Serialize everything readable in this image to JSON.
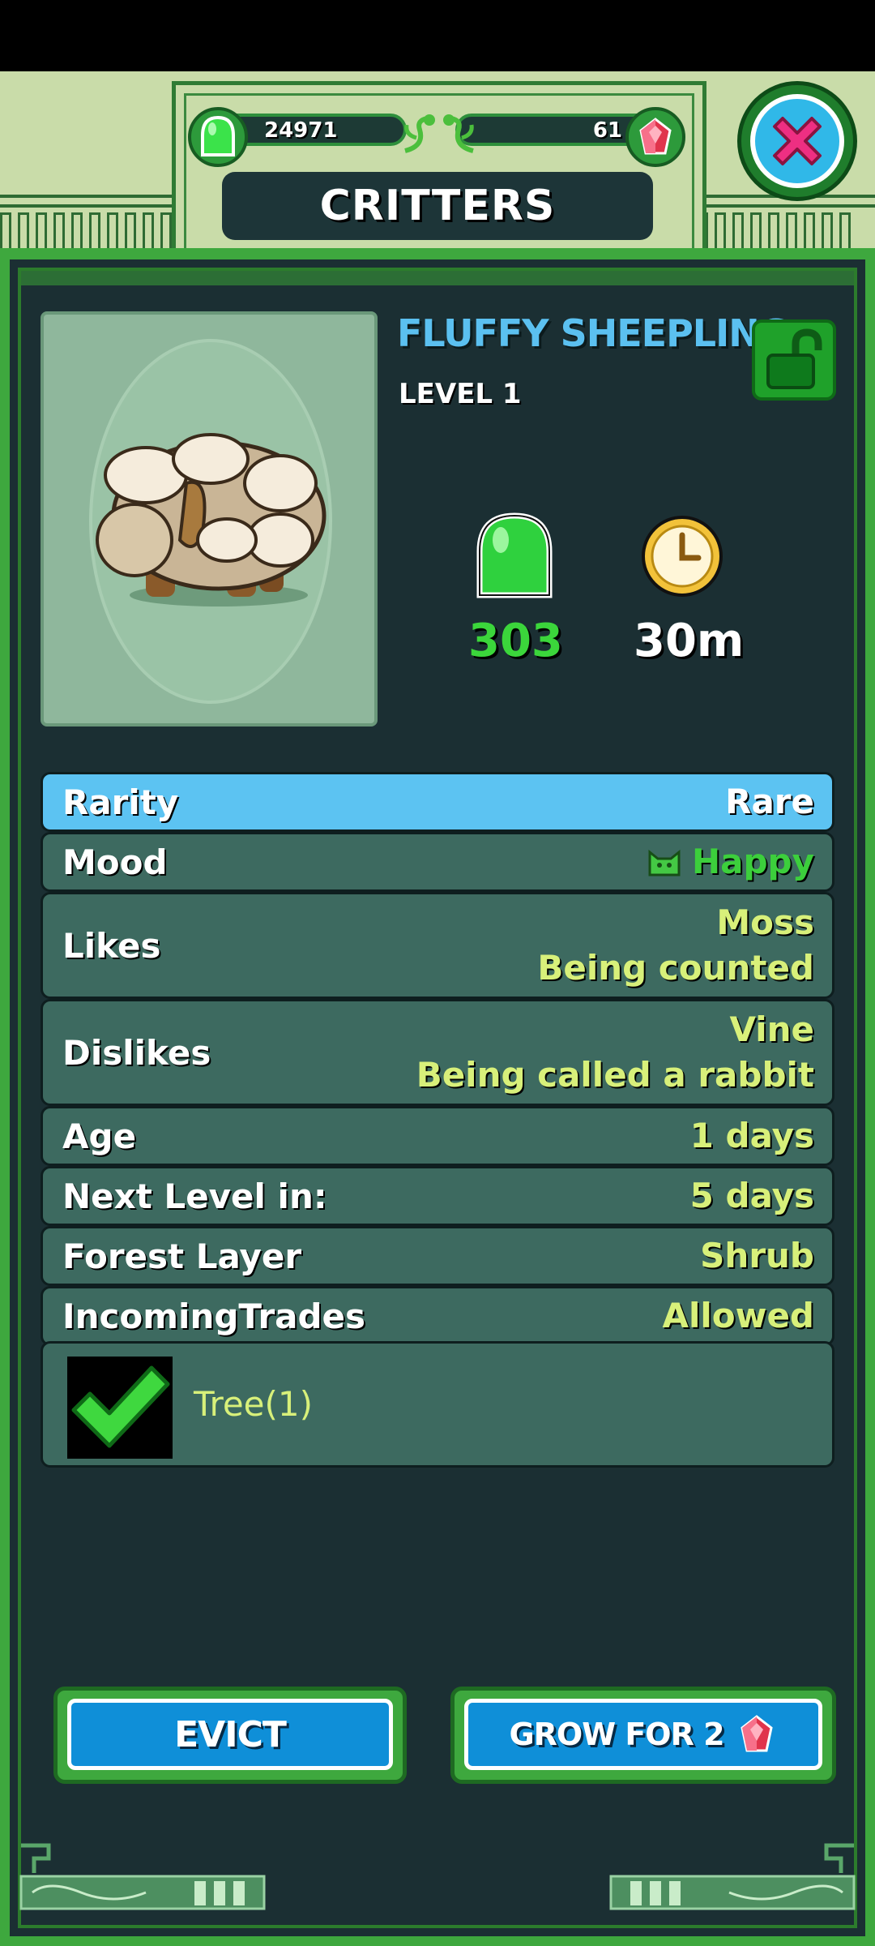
{
  "header": {
    "currency_jelly": "24971",
    "currency_gems": "61",
    "title": "CRITTERS"
  },
  "critter": {
    "name": "FLUFFY SHEEPLING",
    "level": "LEVEL 1",
    "jelly_output": "303",
    "timer": "30m"
  },
  "details": {
    "rows": [
      {
        "label": "Rarity",
        "value": "Rare"
      },
      {
        "label": "Mood",
        "value": "Happy"
      },
      {
        "label": "Likes",
        "value_line1": "Moss",
        "value_line2": "Being counted"
      },
      {
        "label": "Dislikes",
        "value_line1": "Vine",
        "value_line2": "Being called a rabbit"
      },
      {
        "label": "Age",
        "value": "1 days"
      },
      {
        "label": "Next Level in:",
        "value": "5 days"
      },
      {
        "label": "Forest Layer",
        "value": "Shrub"
      },
      {
        "label": "IncomingTrades",
        "value": "Allowed"
      }
    ],
    "habitat": "Tree(1)"
  },
  "actions": {
    "evict_label": "EVICT",
    "grow_label": "GROW FOR 2"
  },
  "colors": {
    "panel_bg": "#1b2f33",
    "frame_green": "#3ea83e",
    "row_bg": "#3d6a60",
    "rarity_bg": "#5cc3f2",
    "value_yellow": "#d8f07a",
    "name_blue": "#5bc0f0",
    "button_blue": "#0f8fd8"
  },
  "icons": {
    "jelly": "green-jelly-icon",
    "gem": "red-gem-icon",
    "clock": "clock-icon",
    "lock": "unlocked-padlock-icon",
    "mood": "cat-face-icon",
    "check": "checkmark-icon",
    "close": "close-x-icon"
  }
}
